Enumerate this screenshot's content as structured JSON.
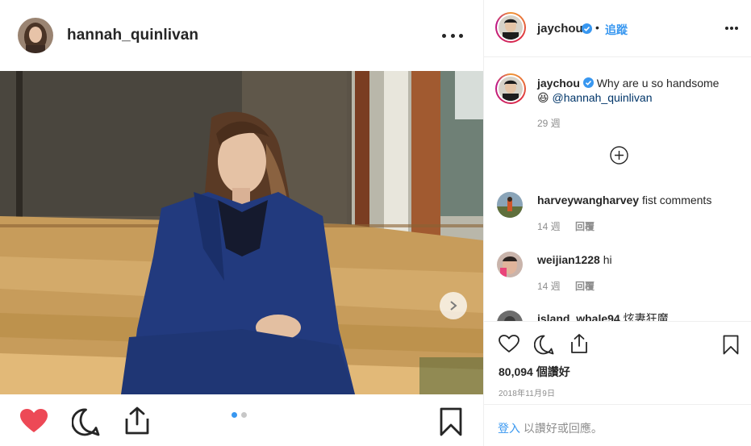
{
  "post": {
    "author": "hannah_quinlivan",
    "likes": "80,094 個讚好",
    "date": "2018年11月9日",
    "carousel": {
      "current": 1,
      "total": 2
    }
  },
  "side": {
    "account": "jaychou",
    "separator": "•",
    "follow_label": "追蹤",
    "caption": {
      "author": "jaychou",
      "text": "Why are u so handsome",
      "emoji": "😆",
      "mention": "@hannah_quinlivan",
      "time": "29 週"
    },
    "comments": [
      {
        "user": "harveywangharvey",
        "text": "fist comments",
        "time": "14 週",
        "reply": "回覆"
      },
      {
        "user": "weijian1228",
        "text": "hi",
        "time": "14 週",
        "reply": "回覆"
      },
      {
        "user": "island_whale94",
        "text": "炫妻狂魔",
        "time": "",
        "reply": ""
      }
    ],
    "login_link": "登入",
    "login_rest": " 以讚好或回應。"
  },
  "colors": {
    "like_red": "#ed4956",
    "link_blue": "#3897f0",
    "verified_blue": "#3897f0",
    "muted": "#8e8e8e"
  },
  "icons": [
    "more-icon",
    "chevron-right-icon",
    "heart-icon",
    "comment-icon",
    "share-icon",
    "bookmark-icon",
    "verified-icon",
    "plus-circle-icon"
  ]
}
